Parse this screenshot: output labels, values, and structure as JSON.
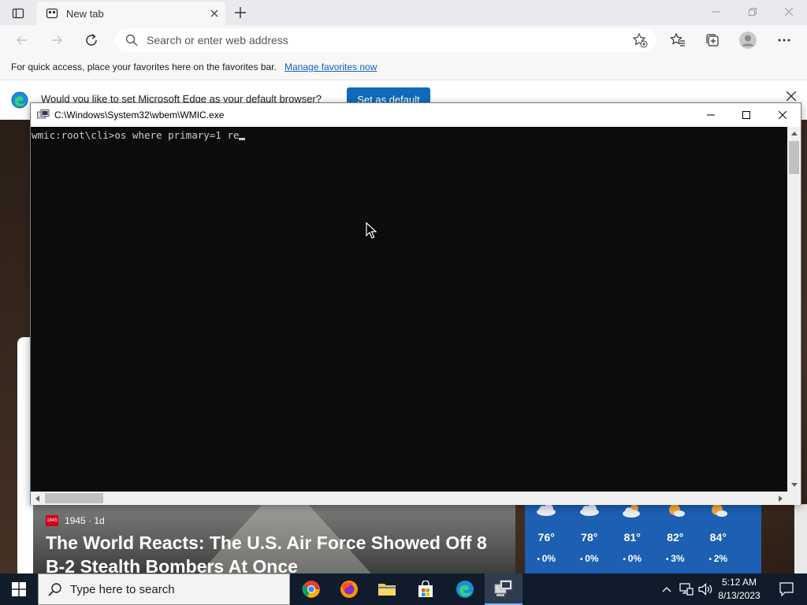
{
  "browser": {
    "tab": {
      "title": "New tab"
    },
    "address": {
      "placeholder": "Search or enter web address"
    },
    "favorites_bar": {
      "text": "For quick access, place your favorites here on the favorites bar.",
      "link": "Manage favorites now"
    },
    "infobar": {
      "text": "Would you like to set Microsoft Edge as your default browser?",
      "button": "Set as default"
    }
  },
  "news": {
    "source": "1945 · 1d",
    "badge": "1945",
    "headline": "The World Reacts: The U.S. Air Force Showed Off 8 B-2 Stealth Bombers At Once"
  },
  "weather": [
    {
      "temp": "76°",
      "rain": "0%",
      "icon": "cloud-icon"
    },
    {
      "temp": "78°",
      "rain": "0%",
      "icon": "cloud-icon"
    },
    {
      "temp": "81°",
      "rain": "0%",
      "icon": "partly-cloudy-icon"
    },
    {
      "temp": "82°",
      "rain": "3%",
      "icon": "sun-cloud-icon"
    },
    {
      "temp": "84°",
      "rain": "2%",
      "icon": "sun-cloud-icon"
    }
  ],
  "console": {
    "title": "C:\\Windows\\System32\\wbem\\WMIC.exe",
    "line": "wmic:root\\cli>os where primary=1 re"
  },
  "taskbar": {
    "search_placeholder": "Type here to search",
    "time": "5:12 AM",
    "date": "8/13/2023"
  },
  "colors": {
    "edge_accent": "#0f6cbd",
    "console_bg": "#0c0c0c",
    "console_text": "#cccccc",
    "taskbar_bg": "#101c2b",
    "weather_bg": "#1c5fb3"
  }
}
